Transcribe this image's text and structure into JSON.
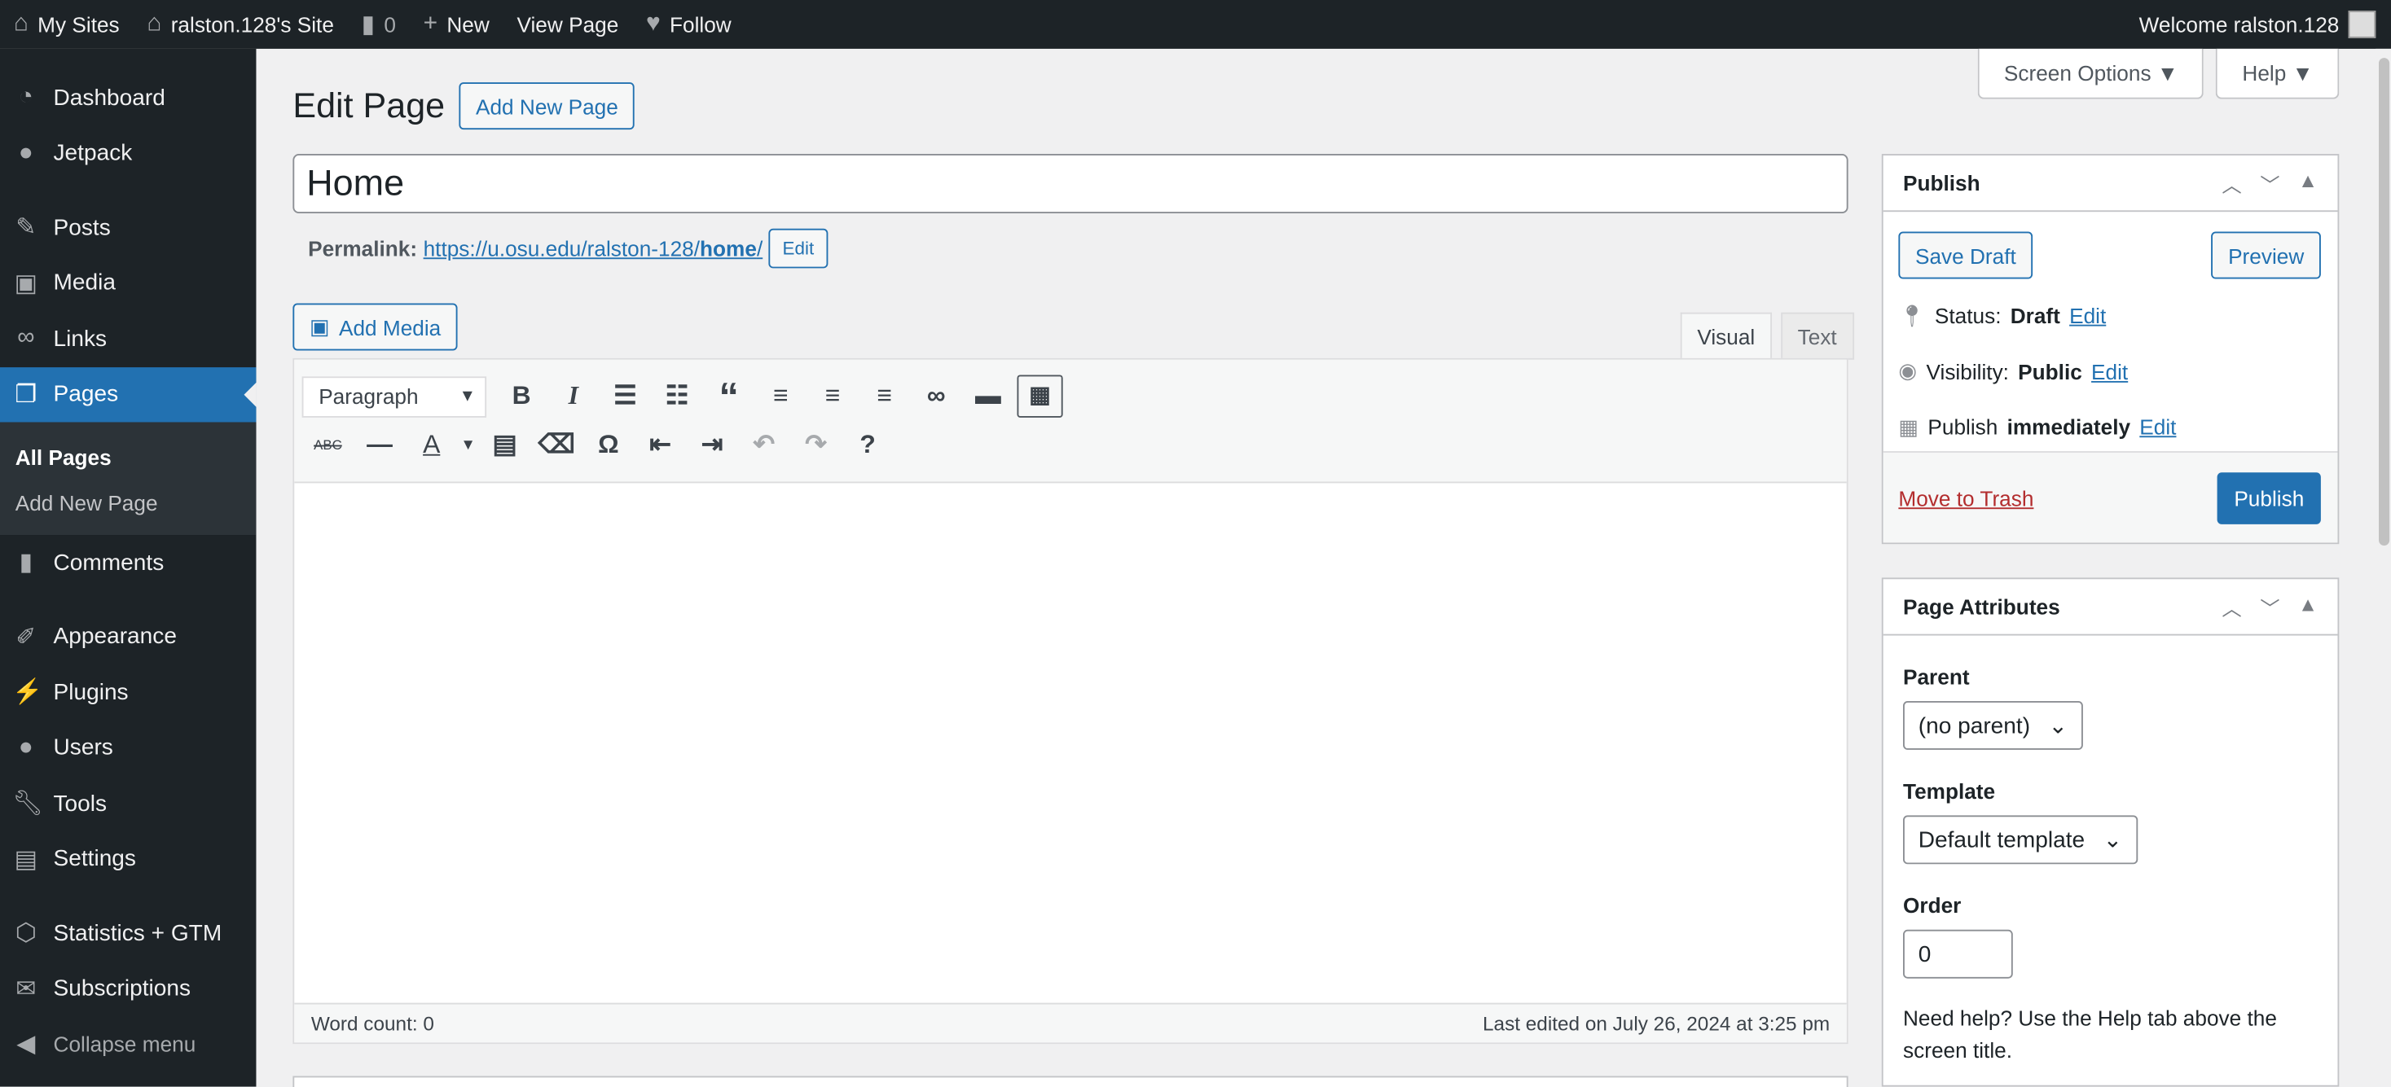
{
  "topbar": {
    "my_sites": "My Sites",
    "site": "ralston.128's Site",
    "comments": "0",
    "new": "New",
    "view": "View Page",
    "follow": "Follow",
    "welcome": "Welcome ralston.128"
  },
  "sidebar": {
    "items": [
      {
        "label": "Dashboard",
        "icon": "dashboard-icon"
      },
      {
        "label": "Jetpack",
        "icon": "jetpack-icon"
      },
      {
        "label": "Posts",
        "icon": "pin-icon"
      },
      {
        "label": "Media",
        "icon": "media-icon"
      },
      {
        "label": "Links",
        "icon": "link-icon"
      },
      {
        "label": "Pages",
        "icon": "pages-icon"
      },
      {
        "label": "Comments",
        "icon": "comment-icon"
      },
      {
        "label": "Appearance",
        "icon": "brush-icon"
      },
      {
        "label": "Plugins",
        "icon": "plugin-icon"
      },
      {
        "label": "Users",
        "icon": "user-icon"
      },
      {
        "label": "Tools",
        "icon": "wrench-icon"
      },
      {
        "label": "Settings",
        "icon": "settings-icon"
      },
      {
        "label": "Statistics + GTM",
        "icon": "stats-icon"
      },
      {
        "label": "Subscriptions",
        "icon": "mail-icon"
      },
      {
        "label": "Collapse menu",
        "icon": "collapse-icon"
      }
    ],
    "sub": [
      "All Pages",
      "Add New Page"
    ]
  },
  "header": {
    "screen_options": "Screen Options ▼",
    "help": "Help ▼",
    "title": "Edit Page",
    "add_new": "Add New Page"
  },
  "editor": {
    "title_value": "Home",
    "permalink_label": "Permalink:",
    "permalink_base": "https://u.osu.edu/ralston-128/",
    "permalink_slug": "home",
    "permalink_end": "/",
    "edit": "Edit",
    "add_media": "Add Media",
    "tab_visual": "Visual",
    "tab_text": "Text",
    "format": "Paragraph",
    "word_count": "Word count: 0",
    "last_edited": "Last edited on July 26, 2024 at 3:25 pm"
  },
  "publish": {
    "title": "Publish",
    "save_draft": "Save Draft",
    "preview": "Preview",
    "status_label": "Status:",
    "status": "Draft",
    "visibility_label": "Visibility:",
    "visibility": "Public",
    "publish_label": "Publish",
    "publish_when": "immediately",
    "edit": "Edit",
    "trash": "Move to Trash",
    "publish_btn": "Publish"
  },
  "attributes": {
    "title": "Page Attributes",
    "parent_label": "Parent",
    "parent": "(no parent)",
    "template_label": "Template",
    "template": "Default template",
    "order_label": "Order",
    "order": "0",
    "help": "Need help? Use the Help tab above the screen title."
  },
  "colors": {
    "accent": "#2271b1",
    "admin_bar": "#1d2327",
    "trash": "#b32d2e"
  }
}
